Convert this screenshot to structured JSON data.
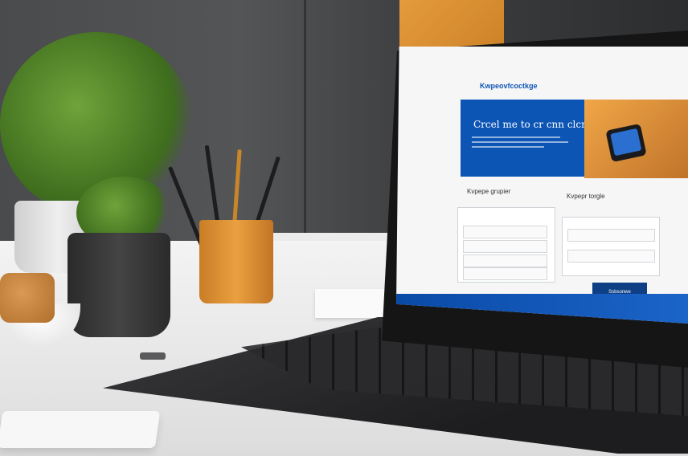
{
  "screen": {
    "brand": "Kwpeovfcoctkge",
    "hero_title": "Crcel me to cr cnn clcmt",
    "section_left_heading": "Kvpepe grupier",
    "section_right_heading": "Kvpepr torgle",
    "submit_label": "Ssbsonwe"
  },
  "colors": {
    "brand_blue": "#0d55b5",
    "accent_orange": "#e39b3c"
  }
}
